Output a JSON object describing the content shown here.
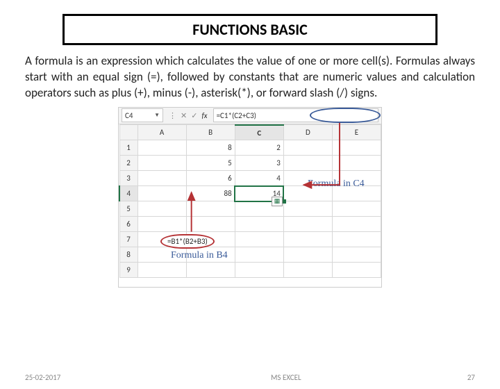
{
  "title": "FUNCTIONS BASIC",
  "body": "A formula is an expression which calculates the value of one or more cell(s). Formulas always start with an equal sign (=), followed by constants that are numeric values and calculation operators such as plus (+), minus (-), asterisk(*), or forward slash (/) signs.",
  "excel": {
    "namebox": "C4",
    "formula_bar": "=C1*(C2+C3)",
    "columns": [
      "A",
      "B",
      "C",
      "D",
      "E"
    ],
    "rows": [
      {
        "n": "1",
        "B": "8",
        "C": "2"
      },
      {
        "n": "2",
        "B": "5",
        "C": "3"
      },
      {
        "n": "3",
        "B": "6",
        "C": "4"
      },
      {
        "n": "4",
        "B": "88",
        "C": "14"
      },
      {
        "n": "5"
      },
      {
        "n": "6"
      },
      {
        "n": "7"
      },
      {
        "n": "8"
      },
      {
        "n": "9"
      }
    ],
    "callout_b4": "=B1*(B2+B3)",
    "callout_c4_label": "Formula in C4",
    "callout_b4_label": "Formula in B4"
  },
  "footer": {
    "date": "25-02-2017",
    "topic": "MS EXCEL",
    "page": "27"
  }
}
